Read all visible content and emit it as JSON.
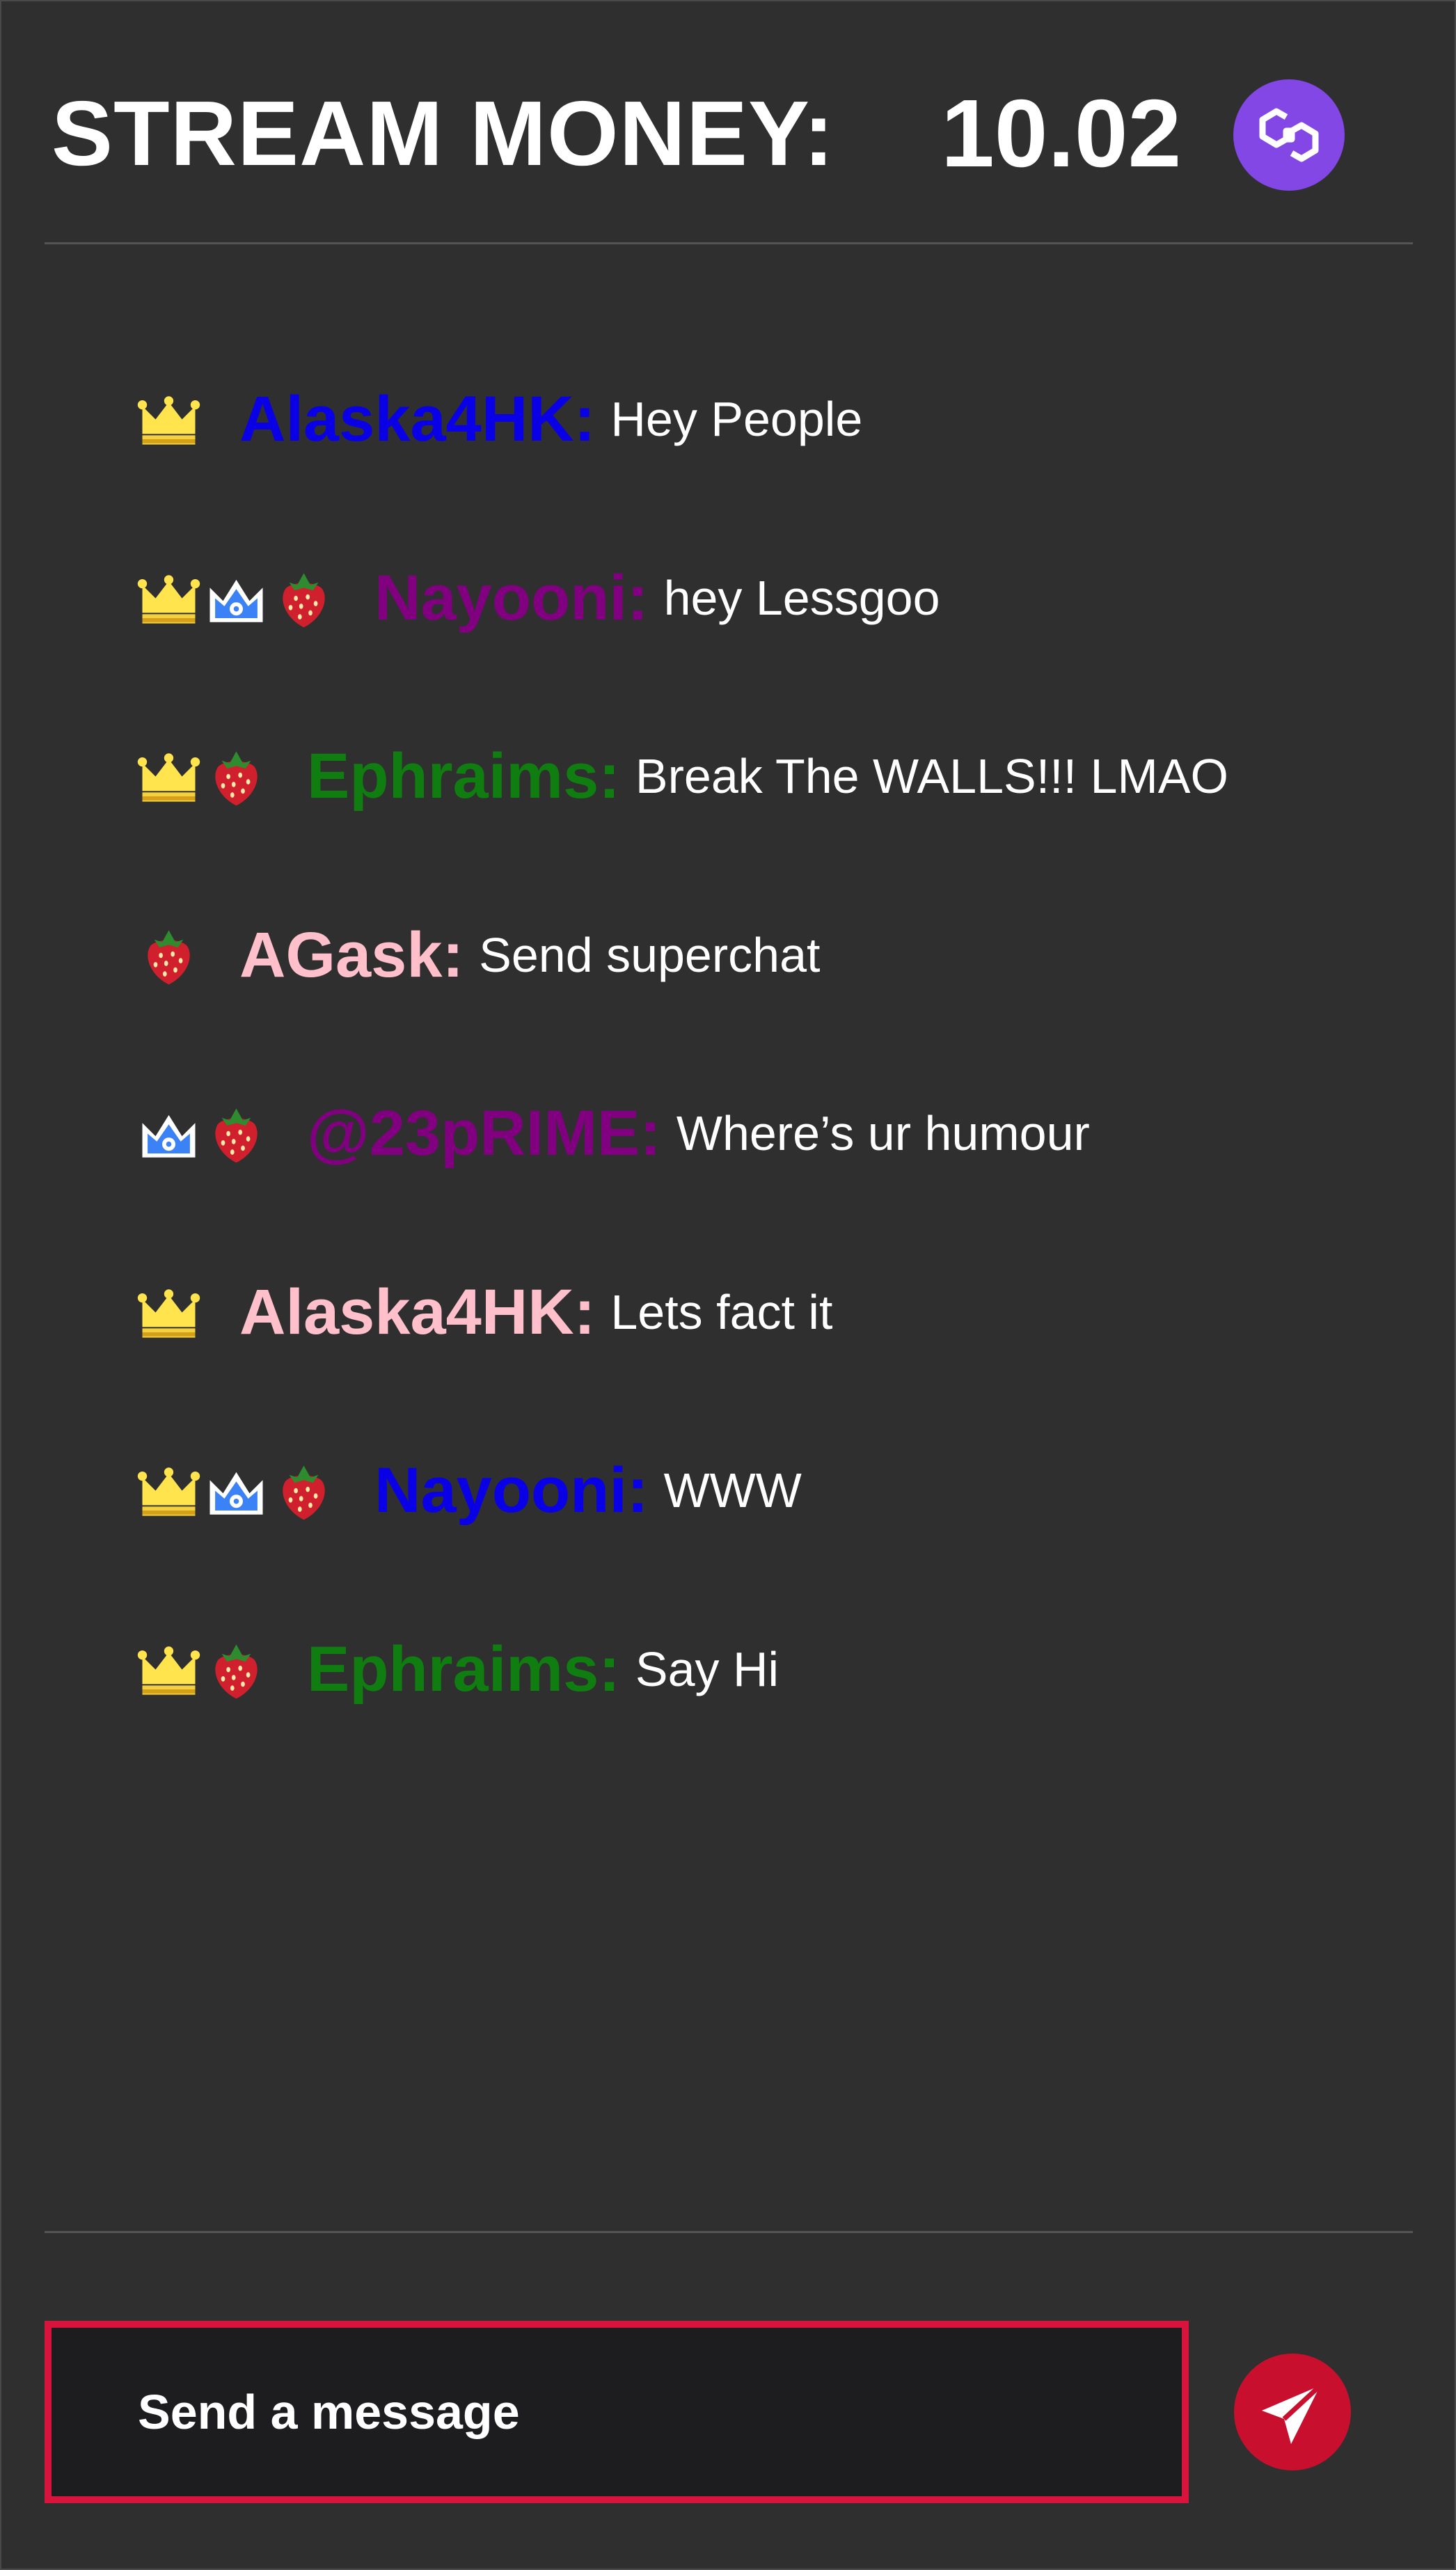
{
  "header": {
    "title": "STREAM MONEY:",
    "amount": "10.02",
    "currency_icon": "polygon-icon",
    "currency_color": "#8247e5"
  },
  "chat": {
    "messages": [
      {
        "badges": [
          "crown"
        ],
        "username": "Alaska4HK:",
        "username_color": "#0a00e6",
        "text": "Hey People"
      },
      {
        "badges": [
          "crown",
          "blue-crown",
          "strawberry"
        ],
        "username": "Nayooni:",
        "username_color": "#800080",
        "text": "hey Lessgoo"
      },
      {
        "badges": [
          "crown",
          "strawberry"
        ],
        "username": "Ephraims:",
        "username_color": "#0f7d0f",
        "text": "Break The WALLS!!! LMAO"
      },
      {
        "badges": [
          "strawberry"
        ],
        "username": "AGask:",
        "username_color": "#ffc0cb",
        "text": "Send superchat"
      },
      {
        "badges": [
          "blue-crown",
          "strawberry"
        ],
        "username": "@23pRIME:",
        "username_color": "#800080",
        "text": "Where’s ur humour"
      },
      {
        "badges": [
          "crown"
        ],
        "username": "Alaska4HK:",
        "username_color": "#ffc0cb",
        "text": "Lets fact it"
      },
      {
        "badges": [
          "crown",
          "blue-crown",
          "strawberry"
        ],
        "username": "Nayooni:",
        "username_color": "#0a00e6",
        "text": "WWW"
      },
      {
        "badges": [
          "crown",
          "strawberry"
        ],
        "username": "Ephraims:",
        "username_color": "#0f7d0f",
        "text": "Say Hi"
      }
    ]
  },
  "composer": {
    "placeholder": "Send a message",
    "send_icon": "paper-plane-icon",
    "accent_color": "#d8143c"
  }
}
